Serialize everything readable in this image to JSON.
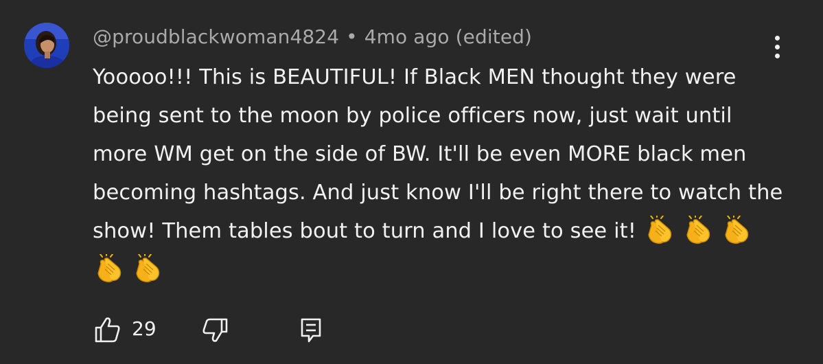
{
  "comment": {
    "author": "@proudblackwoman4824",
    "separator": "•",
    "time": "4mo ago",
    "edited": "(edited)",
    "text": "Yooooo!!! This is BEAUTIFUL! If Black MEN thought they were being sent to the moon by police officers now, just wait until more WM get on the side of BW. It'll be even MORE black men becoming hashtags. And just know I'll be right there to watch the show! Them tables bout to turn and I love to see it!",
    "emojis": [
      "clapping-hands",
      "clapping-hands",
      "clapping-hands",
      "clapping-hands",
      "clapping-hands"
    ],
    "like_count": "29"
  },
  "icons": {
    "like": "thumbs-up-icon",
    "dislike": "thumbs-down-icon",
    "reply": "reply-comment-icon",
    "menu": "more-vertical-icon"
  },
  "colors": {
    "background": "#282828",
    "text_primary": "#f1f1f1",
    "text_secondary": "#aaaaaa",
    "avatar_bg": "#1f3fb8"
  }
}
